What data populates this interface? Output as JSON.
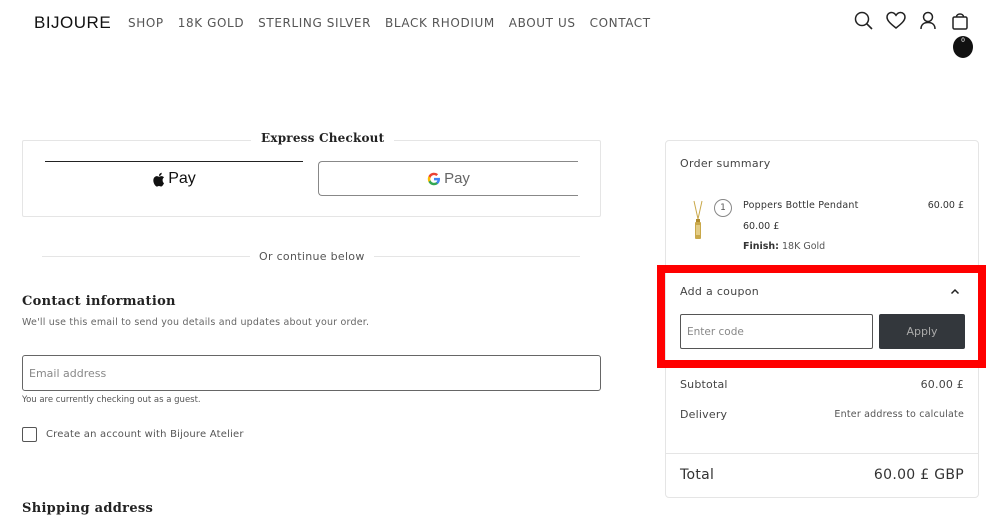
{
  "header": {
    "logo": "BIJOURE",
    "nav": [
      "SHOP",
      "18K GOLD",
      "STERLING SILVER",
      "BLACK RHODIUM",
      "ABOUT US",
      "CONTACT"
    ],
    "bag_count": "0",
    "icons": [
      "search-icon",
      "heart-icon",
      "user-icon",
      "bag-icon"
    ]
  },
  "express": {
    "title": "Express Checkout",
    "apple_pay": "Pay",
    "google_pay": "Pay"
  },
  "divider_text": "Or continue below",
  "contact": {
    "title": "Contact information",
    "subtitle": "We'll use this email to send you details and updates about your order.",
    "email_placeholder": "Email address",
    "guest_note": "You are currently checking out as a guest.",
    "create_account_label": "Create an account with Bijoure Atelier"
  },
  "shipping": {
    "title": "Shipping address"
  },
  "summary": {
    "title": "Order summary",
    "item": {
      "quantity": "1",
      "name": "Poppers Bottle Pendant",
      "price": "60.00 £",
      "unit_price": "60.00 £",
      "finish_label": "Finish:",
      "finish_value": "18K Gold"
    },
    "coupon": {
      "label": "Add a coupon",
      "placeholder": "Enter code",
      "apply_label": "Apply"
    },
    "subtotal_label": "Subtotal",
    "subtotal_value": "60.00 £",
    "delivery_label": "Delivery",
    "delivery_value": "Enter address to calculate",
    "total_label": "Total",
    "total_value": "60.00 £ GBP"
  },
  "colors": {
    "highlight": "#ff0000",
    "apply_button": "#33373c"
  }
}
